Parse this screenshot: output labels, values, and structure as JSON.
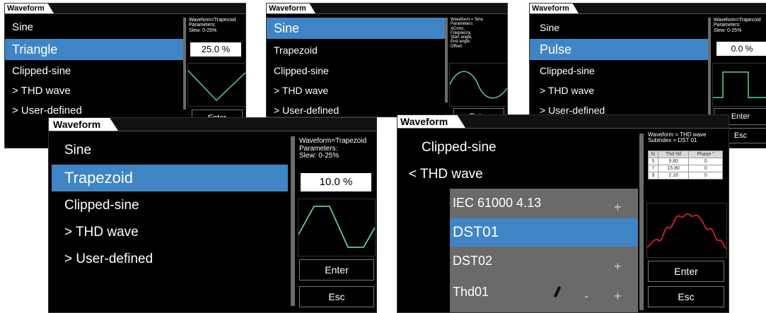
{
  "p1": {
    "tab": "Waveform",
    "items": [
      "Sine",
      "Triangle",
      "Clipped-sine",
      "> THD wave",
      "> User-defined"
    ],
    "info": [
      "Waveform=Trapezoid",
      "Parameters:",
      "Slew: 0-25%"
    ],
    "value": "25.0 %",
    "enter": "Enter"
  },
  "p2": {
    "tab": "Waveform",
    "items": [
      "Sine",
      "Trapezoid",
      "Clipped-sine",
      "> THD wave",
      "> User-defined"
    ],
    "info": [
      "Waveform = Sine",
      "Parameters:",
      "ACrms,",
      "Frequecny,",
      "Start angle,",
      "End angle,",
      "Offset."
    ],
    "enter": "Enter"
  },
  "p3": {
    "tab": "Waveform",
    "items": [
      "Sine",
      "Pulse",
      "Clipped-sine",
      "> THD wave",
      "> User-defined"
    ],
    "info": [
      "Waveform=Trapezoid",
      "Parameters:",
      "Slew: 0-25%"
    ],
    "value": "0.0 %",
    "enter": "Enter",
    "esc": "Esc"
  },
  "p4": {
    "tab": "Waveform",
    "items": [
      "Sine",
      "Trapezoid",
      "Clipped-sine",
      "> THD wave",
      "> User-defined"
    ],
    "info": [
      "Waveform=Trapezoid",
      "Parameters:",
      "Slew: 0-25%"
    ],
    "value": "10.0 %",
    "enter": "Enter",
    "esc": "Esc"
  },
  "p5": {
    "tab": "Waveform",
    "items": [
      "Clipped-sine",
      "< THD wave"
    ],
    "sub_items": [
      "IEC 61000 4.13",
      "DST01",
      "DST02",
      "Thd01"
    ],
    "plus": "+",
    "minus": "-",
    "info": [
      "Waveform = THD wave",
      "Subindex  = DST 01"
    ],
    "table": {
      "headers": [
        "N",
        "Thd %f",
        "Phase °"
      ],
      "rows": [
        [
          "5",
          "9.80",
          "0"
        ],
        [
          "7",
          "15.80",
          "0"
        ],
        [
          "9",
          "2.16",
          "0"
        ]
      ]
    },
    "enter": "Enter",
    "esc": "Esc"
  },
  "colors": {
    "selected": "#3f85c6",
    "wave": "#5fd08a",
    "thd_wave": "#e0202a"
  }
}
